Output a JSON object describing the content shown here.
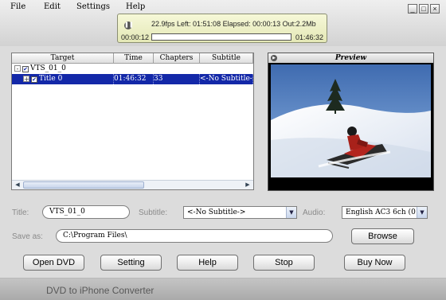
{
  "menu": {
    "file": "File",
    "edit": "Edit",
    "settings": "Settings",
    "help": "Help"
  },
  "window_controls": {
    "minimize": "_",
    "maximize": "□",
    "close": "×"
  },
  "status": {
    "stats": "22.9fps Left: 01:51:08 Elapsed: 00:00:13 Out:2.2Mb",
    "elapsed": "00:00:12",
    "total": "01:46:32",
    "progress": 0.0
  },
  "tree": {
    "headers": {
      "target": "Target",
      "time": "Time",
      "chapters": "Chapters",
      "subtitle": "Subtitle"
    },
    "root": {
      "expander": "-",
      "label": "VTS_01_0"
    },
    "item": {
      "expander": "+",
      "target": "Title 0",
      "time": "01:46:32",
      "chapters": "33",
      "subtitle": "<-No Subtitle->"
    }
  },
  "preview": {
    "title": "Preview"
  },
  "form": {
    "title_label": "Title:",
    "title_value": "VTS_01_0",
    "subtitle_label": "Subtitle:",
    "subtitle_value": "<-No Subtitle->",
    "audio_label": "Audio:",
    "audio_value": "English AC3 6ch (0",
    "save_label": "Save as:",
    "save_value": "C:\\Program Files\\",
    "browse": "Browse"
  },
  "buttons": {
    "open_dvd": "Open DVD",
    "setting": "Setting",
    "help": "Help",
    "stop": "Stop",
    "buy_now": "Buy Now"
  },
  "footer": {
    "title": "DVD to iPhone Converter"
  }
}
